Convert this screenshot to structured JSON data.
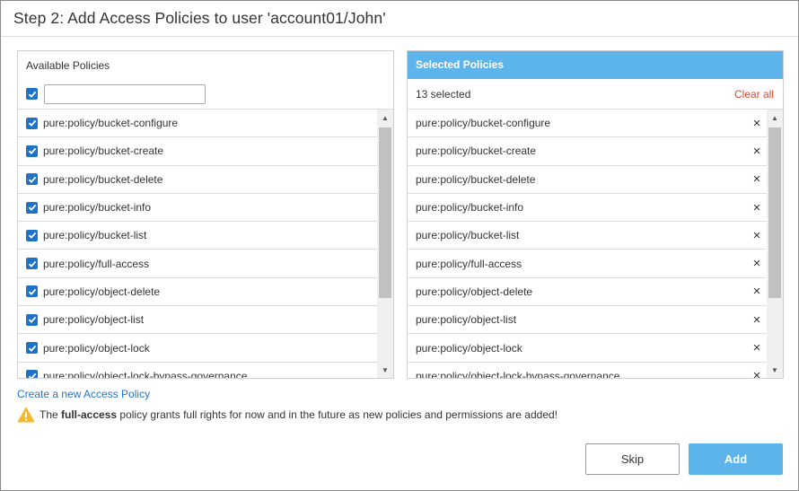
{
  "dialog": {
    "title": "Step 2: Add Access Policies to user 'account01/John'"
  },
  "available": {
    "header": "Available Policies",
    "filter_value": "",
    "policies": [
      "pure:policy/bucket-configure",
      "pure:policy/bucket-create",
      "pure:policy/bucket-delete",
      "pure:policy/bucket-info",
      "pure:policy/bucket-list",
      "pure:policy/full-access",
      "pure:policy/object-delete",
      "pure:policy/object-list",
      "pure:policy/object-lock",
      "pure:policy/object-lock-bypass-governance"
    ]
  },
  "selected": {
    "header": "Selected Policies",
    "count_text": "13 selected",
    "clear_all": "Clear all",
    "remove_glyph": "×",
    "policies": [
      "pure:policy/bucket-configure",
      "pure:policy/bucket-create",
      "pure:policy/bucket-delete",
      "pure:policy/bucket-info",
      "pure:policy/bucket-list",
      "pure:policy/full-access",
      "pure:policy/object-delete",
      "pure:policy/object-list",
      "pure:policy/object-lock",
      "pure:policy/object-lock-bypass-governance"
    ]
  },
  "links": {
    "create_policy": "Create a new Access Policy"
  },
  "warning": {
    "prefix": "The ",
    "emphasis": "full-access",
    "suffix": " policy grants full rights for now and in the future as new policies and permissions are added!",
    "icon": "warning-icon"
  },
  "buttons": {
    "skip": "Skip",
    "add": "Add"
  },
  "colors": {
    "accent": "#5db4ea",
    "checkbox": "#1f73c6",
    "clear_all": "#e8412c",
    "link": "#1f73c6",
    "warning": "#f5b82e"
  }
}
